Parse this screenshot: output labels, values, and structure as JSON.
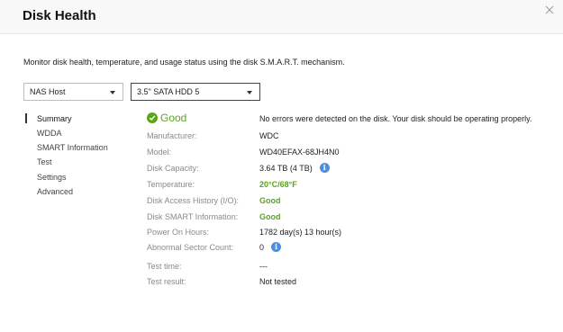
{
  "dialog": {
    "title": "Disk Health",
    "description": "Monitor disk health, temperature, and usage status using the disk S.M.A.R.T. mechanism."
  },
  "selectors": {
    "host": "NAS Host",
    "disk": "3.5\" SATA HDD 5"
  },
  "nav": {
    "items": [
      "Summary",
      "WDDA",
      "SMART Information",
      "Test",
      "Settings",
      "Advanced"
    ],
    "selected": "Summary"
  },
  "summary": {
    "status": "Good",
    "status_message": "No errors were detected on the disk. Your disk should be operating properly.",
    "fields": {
      "manufacturer": {
        "label": "Manufacturer:",
        "value": "WDC"
      },
      "model": {
        "label": "Model:",
        "value": "WD40EFAX-68JH4N0"
      },
      "capacity": {
        "label": "Disk Capacity:",
        "value": "3.64 TB (4 TB)"
      },
      "temperature": {
        "label": "Temperature:",
        "value": "20°C/68°F"
      },
      "access_history": {
        "label": "Disk Access History (I/O):",
        "value": "Good"
      },
      "smart_info": {
        "label": "Disk SMART Information:",
        "value": "Good"
      },
      "power_on_hours": {
        "label": "Power On Hours:",
        "value": "1782 day(s) 13 hour(s)"
      },
      "abnormal_sectors": {
        "label": "Abnormal Sector Count:",
        "value": "0"
      },
      "test_time": {
        "label": "Test time:",
        "value": "---"
      },
      "test_result": {
        "label": "Test result:",
        "value": "Not tested"
      }
    }
  },
  "icons": {
    "close": "close-icon",
    "status": "check-circle-icon",
    "info": "info-icon"
  },
  "colors": {
    "good": "#58a815",
    "info": "#4a90e2"
  }
}
